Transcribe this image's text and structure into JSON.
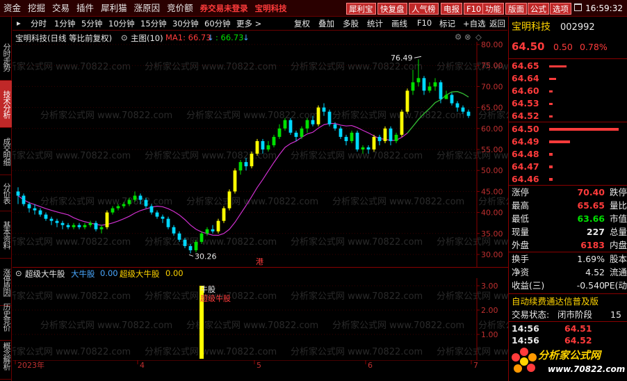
{
  "menu": {
    "items": [
      "资金",
      "挖掘",
      "交易",
      "插件",
      "犀利猫",
      "涨原因",
      "竞价额"
    ],
    "notice1": "券交易未登录",
    "notice2": "宝明科技",
    "buttons": [
      "犀利宝",
      "快复盘",
      "人气榜",
      "电报",
      "F10",
      "功能",
      "版面",
      "公式",
      "选项"
    ],
    "clock": "16:59:32"
  },
  "side_tabs": [
    {
      "label": "分时走势",
      "active": false
    },
    {
      "label": "技术分析",
      "active": true
    },
    {
      "label": "成交明细",
      "active": false
    },
    {
      "label": "分价表",
      "active": false
    },
    {
      "label": "基本资料",
      "active": false
    },
    {
      "label": "涨停原因",
      "active": false
    },
    {
      "label": "历史竞价",
      "active": false
    },
    {
      "label": "概念解析",
      "active": false
    }
  ],
  "periods": [
    "分时",
    "1分钟",
    "5分钟",
    "10分钟",
    "15分钟",
    "30分钟",
    "60分钟",
    "更多 >"
  ],
  "tools": [
    "复权",
    "叠加",
    "多股",
    "统计",
    "画线",
    "F10",
    "标记",
    "+自选",
    "返回"
  ],
  "chart_header": {
    "title": "宝明科技(日线 等比前复权)",
    "main": "主图(10)",
    "ma_label": "MA1: 66.73",
    "ma_value2": ": 66.73"
  },
  "watermark": "分析家公式网 www.70822.com",
  "chart_data": {
    "type": "candlestick",
    "y_ticks": [
      "80.00",
      "75.00",
      "70.00",
      "65.00",
      "60.00",
      "55.00",
      "50.00",
      "45.00",
      "40.00",
      "35.00",
      "30.00"
    ],
    "ylim": [
      30,
      80
    ],
    "max_label": "76.49",
    "min_label": "30.26",
    "hk_mark": "港",
    "month_labels": [
      "2023年",
      "4",
      "5",
      "6",
      "7"
    ],
    "candles": [
      [
        45,
        44,
        46,
        42
      ],
      [
        44,
        42,
        44.5,
        41.5
      ],
      [
        42,
        41,
        42.5,
        40
      ],
      [
        41,
        40.5,
        42,
        39.5
      ],
      [
        40.5,
        39.5,
        41,
        39
      ],
      [
        39.5,
        38.5,
        40,
        38
      ],
      [
        38.5,
        38,
        39,
        37
      ],
      [
        38,
        37.5,
        38.5,
        36.5
      ],
      [
        37.5,
        37,
        38,
        36
      ],
      [
        37,
        36.5,
        37.5,
        36
      ],
      [
        36.5,
        37,
        37.5,
        36
      ],
      [
        37,
        36.5,
        37.5,
        36
      ],
      [
        36.5,
        37,
        37.5,
        36
      ],
      [
        37,
        37.5,
        38,
        36.5
      ],
      [
        37.5,
        36,
        38,
        35.5
      ],
      [
        36,
        36.5,
        37,
        35
      ],
      [
        36.5,
        40,
        40.5,
        36
      ],
      [
        40,
        41,
        41.5,
        39.5
      ],
      [
        41,
        41.5,
        42,
        40.5
      ],
      [
        41.5,
        42,
        42.5,
        41
      ],
      [
        42,
        43,
        43.5,
        41.5
      ],
      [
        43,
        44,
        45,
        42.5
      ],
      [
        44,
        43,
        44.5,
        42
      ],
      [
        43,
        41.5,
        43.5,
        41
      ],
      [
        41.5,
        40,
        42,
        39.5
      ],
      [
        40,
        39,
        40.5,
        38.5
      ],
      [
        39,
        38.5,
        39.5,
        37.5
      ],
      [
        38.5,
        36.5,
        39,
        36
      ],
      [
        36.5,
        35,
        37,
        34.5
      ],
      [
        35,
        33.5,
        35.5,
        33
      ],
      [
        33.5,
        32,
        34,
        31.5
      ],
      [
        32,
        31,
        32.5,
        30.26
      ],
      [
        31,
        33,
        33.5,
        30.5
      ],
      [
        33,
        35,
        35.5,
        32.5
      ],
      [
        35,
        36,
        36.5,
        34.5
      ],
      [
        36,
        35.5,
        37,
        35
      ],
      [
        35.5,
        38,
        38.5,
        35
      ],
      [
        38,
        41,
        41.5,
        37.5
      ],
      [
        41,
        45,
        45.5,
        40.5
      ],
      [
        45,
        50,
        50.5,
        44.5
      ],
      [
        50,
        52,
        52.5,
        49
      ],
      [
        52,
        51,
        53,
        50
      ],
      [
        51,
        54,
        54.5,
        50.5
      ],
      [
        54,
        57,
        57.5,
        53.5
      ],
      [
        57,
        55,
        57.5,
        54
      ],
      [
        55,
        56,
        57,
        54.5
      ],
      [
        56,
        58,
        58.5,
        55.5
      ],
      [
        58,
        60,
        61,
        57.5
      ],
      [
        60,
        62,
        62.5,
        59.5
      ],
      [
        62,
        59,
        62.5,
        58.5
      ],
      [
        59,
        58,
        59.5,
        57
      ],
      [
        58,
        60,
        60.5,
        57.5
      ],
      [
        60,
        62,
        62.5,
        59
      ],
      [
        62,
        61,
        63,
        60.5
      ],
      [
        61,
        65,
        65.5,
        60.5
      ],
      [
        65,
        64,
        66,
        63
      ],
      [
        64,
        61,
        64.5,
        60.5
      ],
      [
        61,
        60,
        61.5,
        59.5
      ],
      [
        60,
        58,
        60.5,
        57.5
      ],
      [
        58,
        57,
        58.5,
        56
      ],
      [
        57,
        59,
        59.5,
        56.5
      ],
      [
        59,
        55,
        59.5,
        54.5
      ],
      [
        55,
        55.5,
        56,
        54
      ],
      [
        55.5,
        55,
        56,
        54
      ],
      [
        55,
        58,
        58.5,
        54.5
      ],
      [
        58,
        57,
        58.5,
        56
      ],
      [
        57,
        60,
        60.5,
        56.5
      ],
      [
        60,
        57,
        60.5,
        56
      ],
      [
        57,
        58.5,
        59,
        56.5
      ],
      [
        58.5,
        64,
        64.5,
        58
      ],
      [
        64,
        69,
        69.5,
        63.5
      ],
      [
        69,
        71,
        74,
        68
      ],
      [
        71,
        72,
        76.49,
        70
      ],
      [
        72,
        69,
        72.5,
        68
      ],
      [
        69,
        70,
        71,
        68.5
      ],
      [
        70,
        71,
        72,
        69
      ],
      [
        71,
        67,
        71.5,
        66
      ],
      [
        67,
        68,
        69,
        67
      ],
      [
        68,
        66,
        68.5,
        65.5
      ],
      [
        66,
        65,
        66.5,
        64
      ],
      [
        65,
        64,
        65.5,
        63.5
      ],
      [
        64,
        63,
        64.5,
        62.5
      ]
    ],
    "ma_start_value": 44,
    "indicator": {
      "title": "超级大牛股",
      "series": [
        {
          "name": "大牛股",
          "value": "0.00"
        },
        {
          "name": "超级大牛股",
          "value": "0.00"
        }
      ],
      "y_ticks": [
        "3.00",
        "2.00",
        "1.00"
      ],
      "ylim": [
        0,
        3.2
      ],
      "signal_index": 33,
      "signal_value": 3,
      "signal_label1": "牛股",
      "signal_label2": "超级牛股"
    }
  },
  "quote": {
    "name": "宝明科技",
    "code": "002992",
    "price": "64.50",
    "change": "0.50",
    "pct": "0.78%",
    "asks": [
      {
        "price": "64.65",
        "bar": 0.25
      },
      {
        "price": "64.64",
        "bar": 0.1
      },
      {
        "price": "64.60",
        "bar": 0.05
      },
      {
        "price": "64.53",
        "bar": 0.05
      },
      {
        "price": "64.52",
        "bar": 0.05
      }
    ],
    "bids": [
      {
        "price": "64.50",
        "bar": 1.0
      },
      {
        "price": "64.49",
        "bar": 0.3
      },
      {
        "price": "64.48",
        "bar": 0.05
      },
      {
        "price": "64.47",
        "bar": 0.05
      },
      {
        "price": "64.46",
        "bar": 0.05
      }
    ],
    "stats": [
      {
        "l": "涨停",
        "v": "70.40",
        "r": "跌停",
        "color": "#ff3b3b"
      },
      {
        "l": "最高",
        "v": "65.65",
        "r": "量比",
        "color": "#ff3b3b"
      },
      {
        "l": "最低",
        "v": "63.66",
        "r": "市值",
        "color": "#00e000"
      },
      {
        "l": "现量",
        "v": "227",
        "r": "总量",
        "color": "#e8e8e8"
      },
      {
        "l": "外盘",
        "v": "6183",
        "r": "内盘",
        "color": "#ff3b3b"
      }
    ],
    "stats2": [
      {
        "l": "换手",
        "v": "1.69%",
        "r": "股本"
      },
      {
        "l": "净资",
        "v": "4.52",
        "r": "流通"
      },
      {
        "l": "收益(三)",
        "v": "-0.540",
        "r": "PE(动"
      }
    ],
    "ticker": "自动续费通达信普及版",
    "status_label": "交易状态:",
    "status_value": "闭市阶段",
    "status_num": "15",
    "ticks": [
      {
        "time": "14:56",
        "price": "64.51"
      },
      {
        "time": "14:56",
        "price": "64.52"
      }
    ],
    "logo_text": "分析家公式网",
    "logo_url": "www.70822.com"
  }
}
